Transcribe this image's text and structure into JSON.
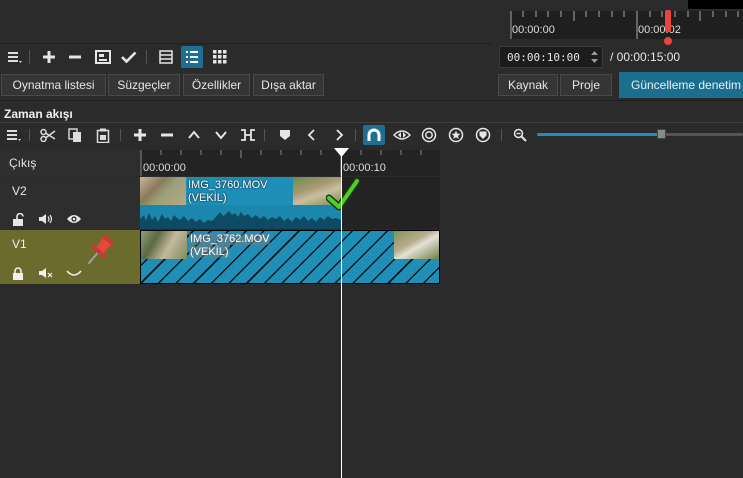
{
  "top_panel": {
    "ruler_marks": [
      "00:00:00",
      "00:00:02"
    ],
    "timecode_value": "00:00:10:00",
    "total_duration": "/ 00:00:15:00"
  },
  "playlist_tabs": [
    "Oynatma listesi",
    "Süzgeçler",
    "Özellikler",
    "Dışa aktar"
  ],
  "player_tabs": [
    "Kaynak",
    "Proje"
  ],
  "update_button": "Güncelleme denetim",
  "timeline": {
    "title": "Zaman akışı",
    "ruler_start": "00:00:00",
    "ruler_mark": "00:00:10",
    "output_label": "Çıkış",
    "tracks": [
      {
        "name": "V2",
        "clip_name": "IMG_3760.MOV",
        "clip_sub": "(VEKİL)"
      },
      {
        "name": "V1",
        "clip_name": "IMG_3762.MOV",
        "clip_sub": "(VEKİL)"
      }
    ],
    "zoom_level": 0.6
  },
  "colors": {
    "accent": "#1f8fb8",
    "update_button_bg": "#1b6e8e",
    "v1_header_bg": "#6b6b2e",
    "playhead": "#ffffff",
    "check_mark": "#4fd12a",
    "pin": "#e8453c"
  },
  "icons": {
    "toolbar": [
      "menu-icon",
      "plus-icon",
      "minus-icon",
      "update-icon",
      "check-icon",
      "table-view-icon",
      "detail-view-icon",
      "icon-view-icon"
    ],
    "timeline_toolbar": [
      "menu-icon",
      "cut-icon",
      "copy-icon",
      "paste-icon",
      "append-icon",
      "remove-icon",
      "lift-icon",
      "overwrite-icon",
      "split-icon",
      "marker-icon",
      "prev-marker-icon",
      "next-marker-icon",
      "snap-icon",
      "scrub-icon",
      "ripple-icon",
      "ripple-all-icon",
      "ripple-markers-icon",
      "zoom-out-icon"
    ]
  }
}
